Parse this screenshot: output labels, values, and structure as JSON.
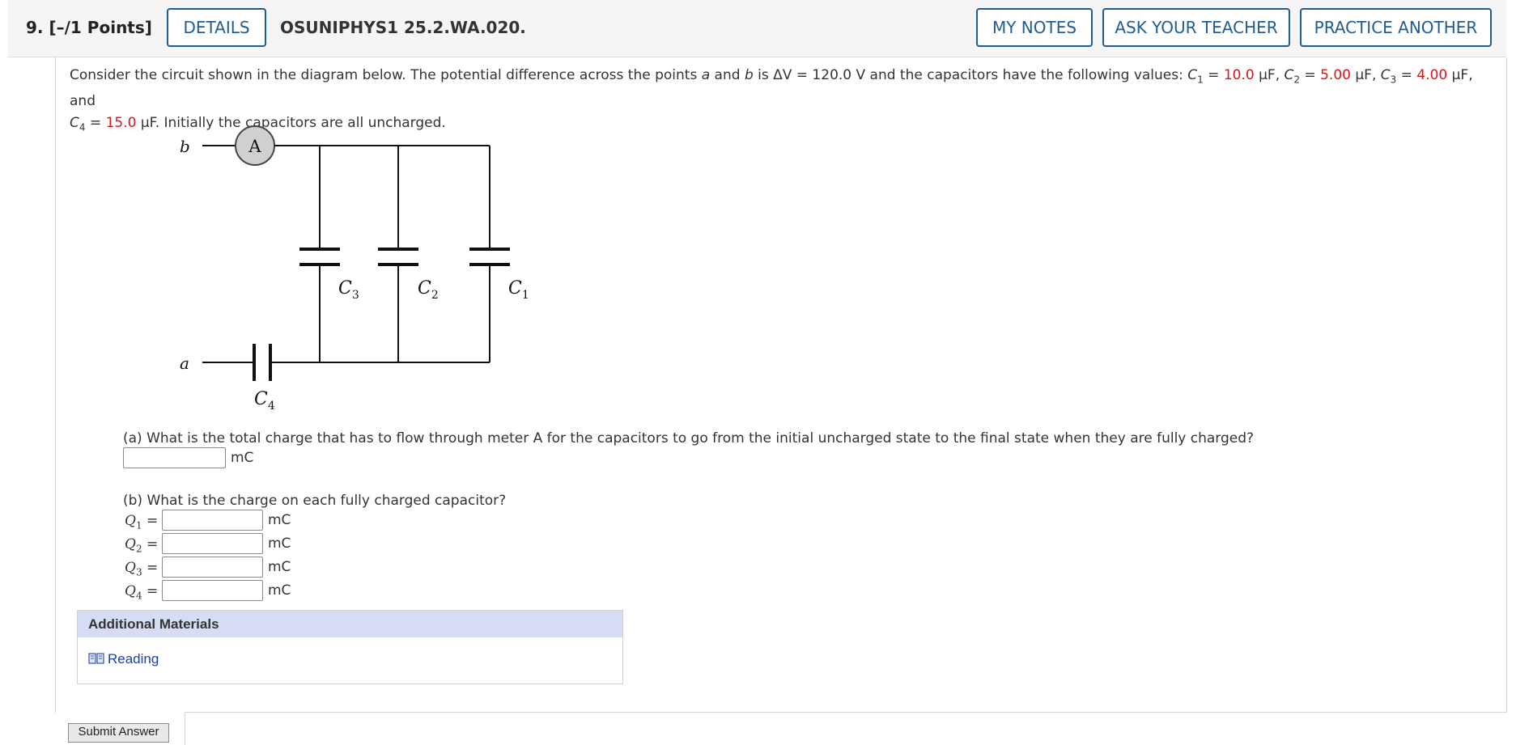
{
  "header": {
    "question_number": "9.",
    "points": "[–/1 Points]",
    "details_label": "DETAILS",
    "question_id": "OSUNIPHYS1 25.2.WA.020.",
    "my_notes_label": "MY NOTES",
    "ask_teacher_label": "ASK YOUR TEACHER",
    "practice_label": "PRACTICE ANOTHER"
  },
  "intro": {
    "p1": "Consider the circuit shown in the diagram below. The potential difference across the points ",
    "a": "a",
    "and": " and ",
    "b": "b",
    "p2": " is ΔV = 120.0 V and the capacitors have the following values: ",
    "c1_label": "C",
    "c1_sub": "1",
    "eq": " = ",
    "c1_val": "10.0",
    "uF_sep1": " μF, ",
    "c2_label": "C",
    "c2_sub": "2",
    "c2_val": "5.00",
    "uF_sep2": " μF, ",
    "c3_label": "C",
    "c3_sub": "3",
    "c3_val": "4.00",
    "uF_and": " μF, and",
    "c4_label": "C",
    "c4_sub": "4",
    "c4_val": "15.0",
    "p3": " μF. Initially the capacitors are all uncharged."
  },
  "diagram": {
    "label_b": "b",
    "label_a": "a",
    "ammeter": "A",
    "c1": "C",
    "c1_sub": "1",
    "c2": "C",
    "c2_sub": "2",
    "c3": "C",
    "c3_sub": "3",
    "c4": "C",
    "c4_sub": "4"
  },
  "part_a": {
    "question": "(a) What is the total charge that has to flow through meter A for the capacitors to go from the initial uncharged state to the final state when they are fully charged?",
    "value": "",
    "unit": "mC"
  },
  "part_b": {
    "question": "(b) What is the charge on each fully charged capacitor?",
    "rows": [
      {
        "label": "Q",
        "sub": "1",
        "eq": "=",
        "value": "",
        "unit": "mC"
      },
      {
        "label": "Q",
        "sub": "2",
        "eq": "=",
        "value": "",
        "unit": "mC"
      },
      {
        "label": "Q",
        "sub": "3",
        "eq": "=",
        "value": "",
        "unit": "mC"
      },
      {
        "label": "Q",
        "sub": "4",
        "eq": "=",
        "value": "",
        "unit": "mC"
      }
    ]
  },
  "additional_materials": {
    "title": "Additional Materials",
    "reading_label": "Reading"
  },
  "submit_label": "Submit Answer"
}
